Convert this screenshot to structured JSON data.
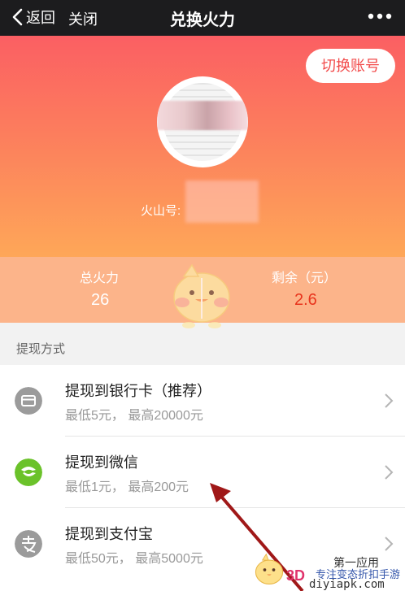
{
  "nav": {
    "back_label": "返回",
    "close_label": "关闭",
    "title": "兑换火力",
    "more_icon": "more-dots-icon"
  },
  "hero": {
    "switch_account_label": "切换账号",
    "uid_label": "火山号:",
    "colors": {
      "gradient_top": "#fb5f63",
      "gradient_bottom": "#fea758",
      "switch_text": "#f24a4a"
    }
  },
  "stats": {
    "total_label": "总火力",
    "total_value": "26",
    "remaining_label": "剩余（元）",
    "remaining_value": "2.6",
    "remaining_color": "#e8341c"
  },
  "methods": {
    "section_title": "提现方式",
    "items": [
      {
        "title": "提现到银行卡（推荐）",
        "subtitle": "最低5元，  最高20000元",
        "icon": "bank-card-icon",
        "icon_color": "#9b9b9b"
      },
      {
        "title": "提现到微信",
        "subtitle": "最低1元，  最高200元",
        "icon": "wechat-icon",
        "icon_color": "#6bc22a"
      },
      {
        "title": "提现到支付宝",
        "subtitle": "最低50元，  最高5000元",
        "icon": "alipay-icon",
        "icon_color": "#9b9b9b"
      }
    ]
  },
  "watermark": {
    "line1": "第一应用",
    "line2": "专注变态折扣手游",
    "line3": "diyiapk.com",
    "logo_text": "3D"
  }
}
